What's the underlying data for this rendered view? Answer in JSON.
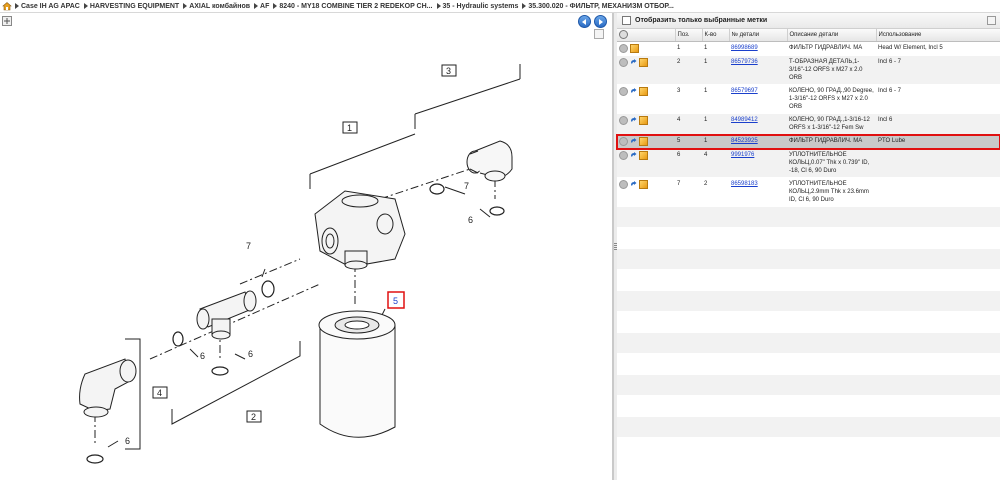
{
  "breadcrumb": {
    "items": [
      "Case IH AG APAC",
      "HARVESTING EQUIPMENT",
      "AXIAL комбайнов",
      "AF",
      "8240 - MY18 COMBINE TIER 2 REDEKOP CH...",
      "35 - Hydraulic systems",
      "35.300.020 - ФИЛЬТР, МЕХАНИЗМ ОТБОР..."
    ]
  },
  "diagram": {
    "callouts": [
      "1",
      "2",
      "3",
      "4",
      "5",
      "6",
      "6",
      "6",
      "6",
      "6",
      "7",
      "7"
    ]
  },
  "filter": {
    "label": "Отобразить только выбранные метки"
  },
  "table": {
    "headers": [
      "Поз.",
      "К-во",
      "№ детали",
      "Описание детали",
      "Использование"
    ],
    "rows": [
      {
        "pos": "1",
        "qty": "1",
        "part": "86998689",
        "desc": "ФИЛЬТР ГИДРАВЛИЧ. МА",
        "usage": "Head W/ Element, Incl 5"
      },
      {
        "pos": "2",
        "qty": "1",
        "part": "86579736",
        "desc": "Т-ОБРАЗНАЯ ДЕТАЛЬ,1-3/16\"-12 ORFS x M27 x 2.0 ORB",
        "usage": "Incl 6 - 7"
      },
      {
        "pos": "3",
        "qty": "1",
        "part": "86579697",
        "desc": "КОЛЕНО, 90 ГРАД.,90 Degree, 1-3/16\"-12 ORFS x M27 x 2.0 ORB",
        "usage": "Incl 6 - 7"
      },
      {
        "pos": "4",
        "qty": "1",
        "part": "84989412",
        "desc": "КОЛЕНО, 90 ГРАД.,1-3/16-12 ORFS x 1-3/16\"-12 Fem Sw",
        "usage": "Incl 6"
      },
      {
        "pos": "5",
        "qty": "1",
        "part": "84523925",
        "desc": "ФИЛЬТР ГИДРАВЛИЧ. МА",
        "usage": "PTO Lube"
      },
      {
        "pos": "6",
        "qty": "4",
        "part": "9991976",
        "desc": "УПЛОТНИТЕЛЬНОЕ КОЛЬЦ,0.07\" Thk x 0.739\" ID, -18, Cl 6, 90 Duro",
        "usage": ""
      },
      {
        "pos": "7",
        "qty": "2",
        "part": "86598183",
        "desc": "УПЛОТНИТЕЛЬНОЕ КОЛЬЦ,2.9mm Thk x 23.6mm ID, Cl 6, 90 Duro",
        "usage": ""
      }
    ],
    "selected_index": 4
  },
  "colors": {
    "link": "#1a3fcc",
    "highlight": "#e01010",
    "selected_row": "#c9c9c9"
  },
  "icons": [
    "home-icon",
    "settings-gear-icon",
    "nav-back-icon",
    "nav-forward-icon",
    "expand-icon",
    "copy-icon",
    "info-icon",
    "cart-box-icon"
  ]
}
